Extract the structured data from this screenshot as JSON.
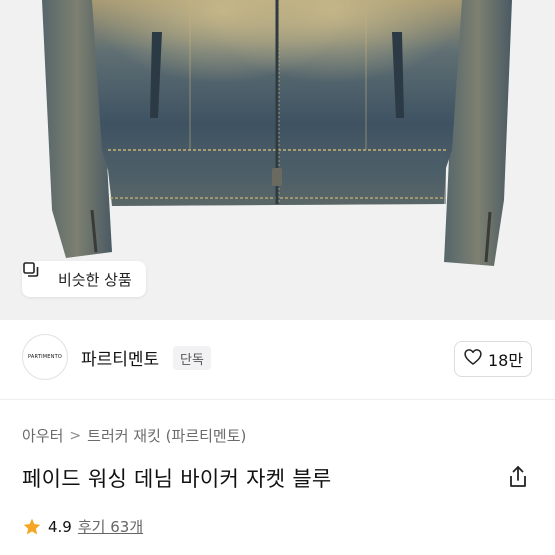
{
  "product_image": {
    "alt_icon": "denim-jacket-image",
    "similar_chip": {
      "label": "비슷한 상품",
      "icon": "similar-items-icon"
    }
  },
  "brand": {
    "logo_text": "PARTIMENTO",
    "name": "파르티멘토",
    "badge": "단독",
    "like_count": "18만",
    "like_icon": "heart-icon"
  },
  "breadcrumb": {
    "items": [
      "아우터",
      "트러커 재킷 (파르티멘토)"
    ],
    "separator": ">"
  },
  "product": {
    "title": "페이드 워싱 데님 바이커 자켓 블루",
    "share_icon": "share-icon"
  },
  "rating": {
    "score": "4.9",
    "reviews_label": "후기 63개",
    "star_color": "#f5a623"
  },
  "colors": {
    "denim_dark": "#3f5160",
    "denim_fade": "#a79a72",
    "background": "#f1f1f1"
  }
}
